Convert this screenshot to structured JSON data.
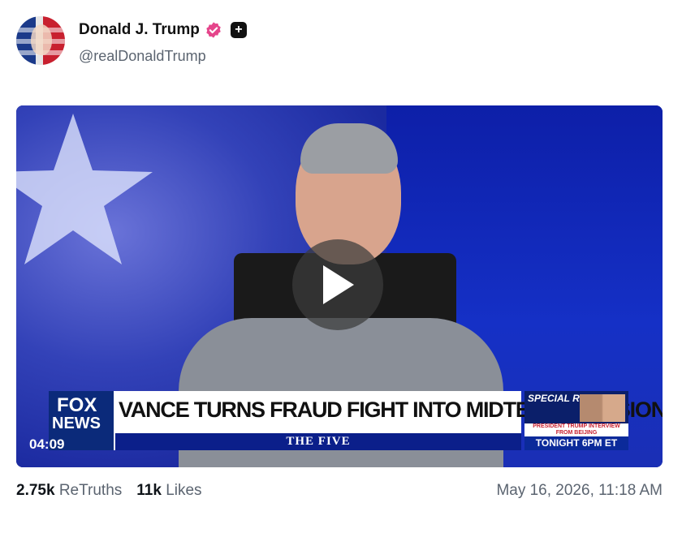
{
  "author": {
    "display_name": "Donald J. Trump",
    "handle": "@realDonaldTrump",
    "avatar_icon": "avatar-flag-portrait",
    "verified_icon": "verified-badge-icon",
    "verified_color": "#e5458b",
    "plus_icon": "plus-badge-icon"
  },
  "video": {
    "chyron": "VANCE TURNS FRAUD FIGHT INTO MIDTERMS MISSION",
    "show_name": "THE FIVE",
    "network_logo_line1": "FOX",
    "network_logo_line2": "NEWS",
    "timecode": "04:09",
    "special_report_label": "SPECIAL REPORT",
    "special_report_subtitle": "PRESIDENT TRUMP INTERVIEW FROM BEIJING",
    "special_report_time": "TONIGHT 6PM ET",
    "play_icon": "play-icon"
  },
  "stats": {
    "retruths_count": "2.75k",
    "retruths_label": "ReTruths",
    "likes_count": "11k",
    "likes_label": "Likes"
  },
  "timestamp": "May 16, 2026, 11:18 AM"
}
